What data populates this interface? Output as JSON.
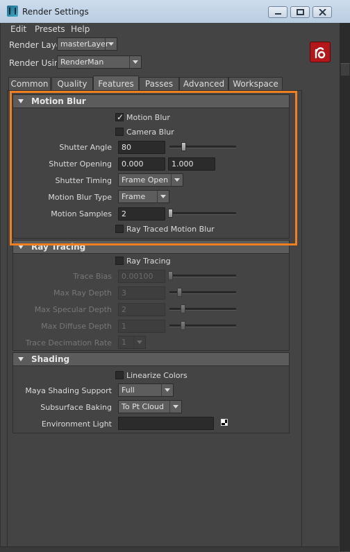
{
  "window": {
    "title": "Render Settings"
  },
  "menu": [
    "Edit",
    "Presets",
    "Help"
  ],
  "render_layer": {
    "label": "Render Layer",
    "value": "masterLayer"
  },
  "render_using": {
    "label": "Render Using",
    "value": "RenderMan"
  },
  "tabs": [
    "Common",
    "Quality",
    "Features",
    "Passes",
    "Advanced",
    "Workspace"
  ],
  "active_tab": "Features",
  "motion_blur": {
    "title": "Motion Blur",
    "motion_blur_checkbox": "Motion Blur",
    "camera_blur_checkbox": "Camera Blur",
    "shutter_angle": {
      "label": "Shutter Angle",
      "value": "80",
      "slider": 0.22
    },
    "shutter_opening": {
      "label": "Shutter Opening",
      "value1": "0.000",
      "value2": "1.000"
    },
    "shutter_timing": {
      "label": "Shutter Timing",
      "value": "Frame Open"
    },
    "motion_blur_type": {
      "label": "Motion Blur Type",
      "value": "Frame"
    },
    "motion_samples": {
      "label": "Motion Samples",
      "value": "2",
      "slider": 0.0
    },
    "ray_traced_checkbox": "Ray Traced Motion Blur"
  },
  "ray_tracing": {
    "title": "Ray Tracing",
    "checkbox": "Ray Tracing",
    "trace_bias": {
      "label": "Trace Bias",
      "value": "0.00100",
      "slider": 0.0
    },
    "max_ray_depth": {
      "label": "Max Ray Depth",
      "value": "3",
      "slider": 0.12
    },
    "max_specular_depth": {
      "label": "Max Specular Depth",
      "value": "2",
      "slider": 0.19
    },
    "max_diffuse_depth": {
      "label": "Max Diffuse Depth",
      "value": "1",
      "slider": 0.19
    },
    "trace_decimation_rate": {
      "label": "Trace Decimation Rate",
      "value": "1"
    }
  },
  "shading": {
    "title": "Shading",
    "linearize_checkbox": "Linearize Colors",
    "maya_shading_support": {
      "label": "Maya Shading Support",
      "value": "Full"
    },
    "subsurface_baking": {
      "label": "Subsurface Baking",
      "value": "To Pt Cloud"
    },
    "environment_light": {
      "label": "Environment Light",
      "value": ""
    }
  },
  "colors": {
    "highlight": "#f07f1f",
    "renderman_logo": "#b3171a"
  }
}
